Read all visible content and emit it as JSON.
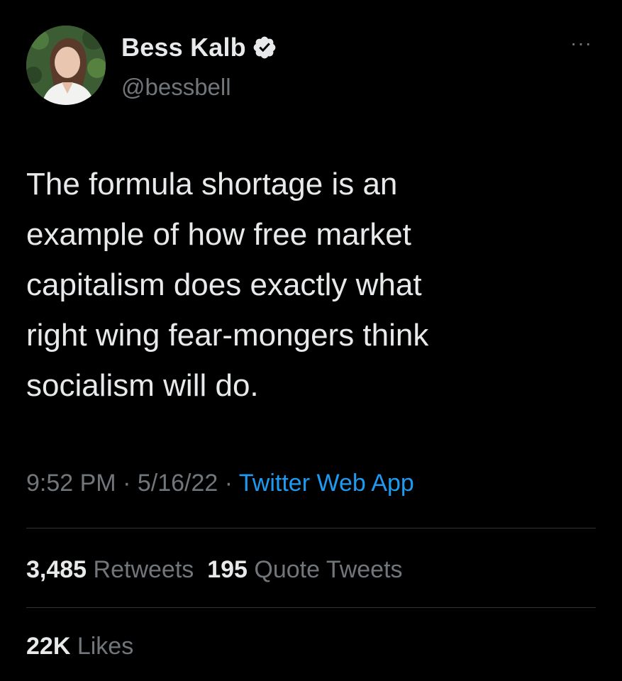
{
  "author": {
    "display_name": "Bess Kalb",
    "handle": "@bessbell",
    "verified": true,
    "avatar_icon": "profile-photo"
  },
  "tweet": {
    "text": "The formula shortage is an\nexample of how free market\ncapitalism does exactly what\nright wing fear-mongers think\nsocialism will do."
  },
  "meta": {
    "time": "9:52 PM",
    "separator_1": " · ",
    "date": "5/16/22",
    "separator_2": " · ",
    "source": "Twitter Web App"
  },
  "stats": {
    "retweets_count": "3,485",
    "retweets_label": "Retweets",
    "quotes_count": "195",
    "quotes_label": "Quote Tweets",
    "likes_count": "22K",
    "likes_label": "Likes"
  },
  "colors": {
    "background": "#000000",
    "text": "#e7e9ea",
    "secondary": "#71767b",
    "link": "#1d9bf0",
    "divider": "#2f3336"
  }
}
